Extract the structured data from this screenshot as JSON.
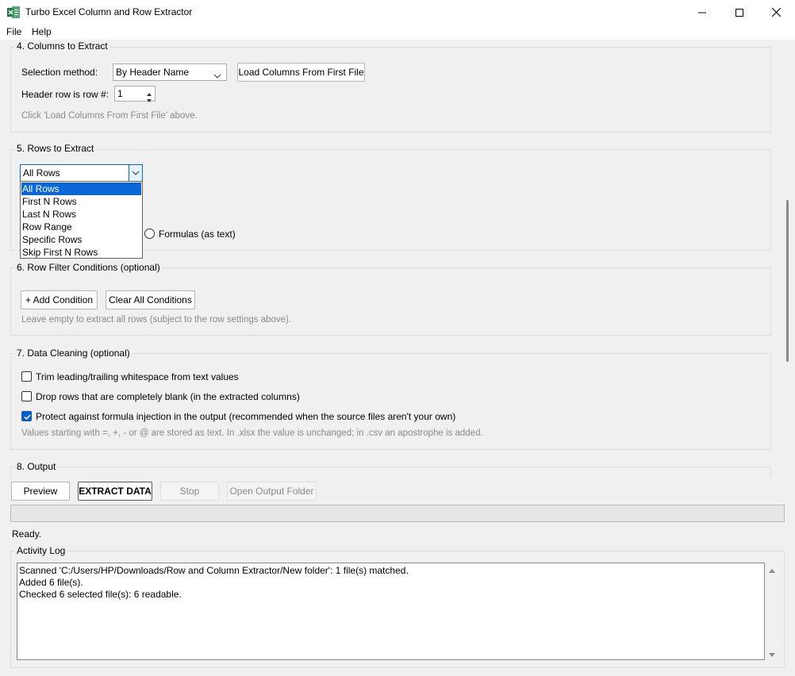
{
  "window": {
    "title": "Turbo Excel Column and Row Extractor"
  },
  "menu": [
    "File",
    "Help"
  ],
  "section4": {
    "title": "4. Columns to Extract",
    "selection_label": "Selection method:",
    "selection_value": "By Header Name",
    "load_button": "Load Columns From First File",
    "header_row_label": "Header row is row #:",
    "header_row_value": "1",
    "hint": "Click 'Load Columns From First File' above."
  },
  "section5": {
    "title": "5. Rows to Extract",
    "rows_value": "All Rows",
    "rows_options": [
      "All Rows",
      "First N Rows",
      "Last N Rows",
      "Row Range",
      "Specific Rows",
      "Skip First N Rows"
    ],
    "formulas_label": "Formulas (as text)"
  },
  "section6": {
    "title": "6. Row Filter Conditions (optional)",
    "add_button": "+ Add Condition",
    "clear_button": "Clear All Conditions",
    "hint": "Leave empty to extract all rows (subject to the row settings above)."
  },
  "section7": {
    "title": "7. Data Cleaning (optional)",
    "trim_label": "Trim leading/trailing whitespace from text values",
    "drop_blank_label": "Drop rows that are completely blank (in the extracted columns)",
    "protect_label": "Protect against formula injection in the output (recommended when the source files aren't your own)",
    "hint": "Values starting with =, +, - or @ are stored as text. In .xlsx the value is unchanged; in .csv an apostrophe is added."
  },
  "section8": {
    "title": "8. Output"
  },
  "actions": {
    "preview": "Preview",
    "extract": "EXTRACT DATA",
    "stop": "Stop",
    "open_folder": "Open Output Folder"
  },
  "status": "Ready.",
  "log": {
    "title": "Activity Log",
    "lines": [
      "Scanned 'C:/Users/HP/Downloads/Row and Column Extractor/New folder': 1 file(s) matched.",
      "Added 6 file(s).",
      "Checked 6 selected file(s): 6 readable."
    ]
  },
  "colors": {
    "accent": "#0b66d6",
    "window_bg": "#f0f0f0"
  }
}
